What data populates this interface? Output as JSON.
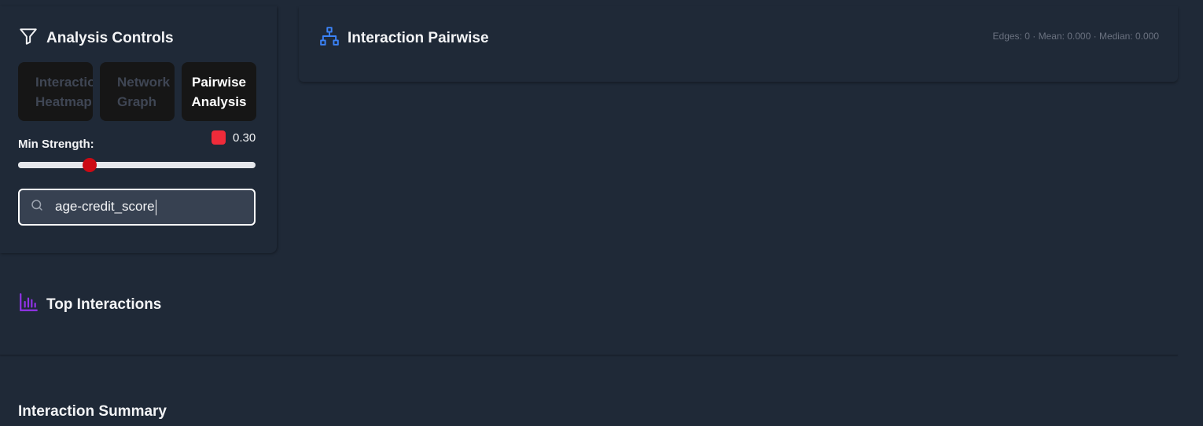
{
  "controls": {
    "title": "Analysis Controls",
    "tabs": [
      {
        "line1": "Interaction",
        "line2": "Heatmap",
        "active": false
      },
      {
        "line1": "Network",
        "line2": "Graph",
        "active": false
      },
      {
        "line1": "Pairwise",
        "line2": "Analysis",
        "active": true
      }
    ],
    "min_strength_label": "Min Strength:",
    "min_strength_value": "0.30",
    "min_strength_fraction": 0.3,
    "swatch_color": "#ef2b3a",
    "search_value": "age-credit_score"
  },
  "pairwise": {
    "title": "Interaction Pairwise",
    "stats": "Edges: 0 · Mean: 0.000 · Median: 0.000"
  },
  "top_interactions": {
    "title": "Top Interactions"
  },
  "summary": {
    "title": "Interaction Summary"
  },
  "colors": {
    "background": "#1f2937",
    "network_icon": "#3b82f6",
    "chart_icon": "#9333ea",
    "slider_thumb": "#cc0a14"
  },
  "icons": {
    "controls": "filter-icon",
    "pairwise": "network-icon",
    "top": "bar-chart-icon",
    "search": "search-icon"
  }
}
